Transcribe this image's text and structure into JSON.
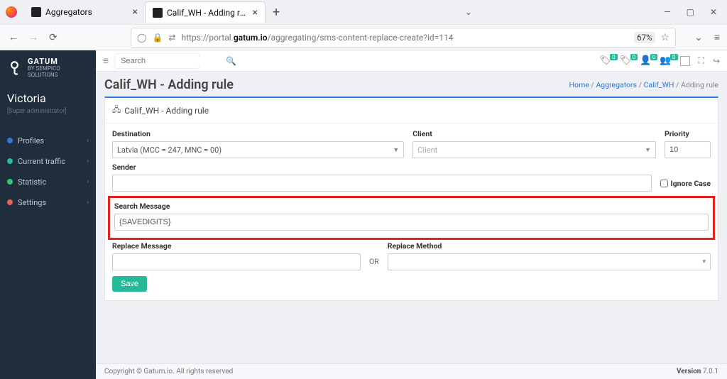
{
  "browser": {
    "tabs": [
      {
        "label": "Aggregators"
      },
      {
        "label": "Calif_WH - Adding rule"
      }
    ],
    "url_prefix": "https://portal.",
    "url_host": "gatum.io",
    "url_path": "/aggregating/sms-content-replace-create?id=114",
    "zoom": "67%"
  },
  "sidebar": {
    "brand_main": "GATUM",
    "brand_sub": "BY SEMPICO SOLUTIONS",
    "user_name": "Victoria",
    "user_role": "[Super administrator]",
    "items": [
      {
        "label": "Profiles",
        "color": "#2f77d0"
      },
      {
        "label": "Current traffic",
        "color": "#26b99a"
      },
      {
        "label": "Statistic",
        "color": "#2ecc71"
      },
      {
        "label": "Settings",
        "color": "#e96058"
      }
    ]
  },
  "topbar": {
    "search_placeholder": "Search",
    "badge": "0"
  },
  "page": {
    "title": "Calif_WH - Adding rule",
    "panel_title": "Calif_WH - Adding rule",
    "crumbs": {
      "home": "Home",
      "sep": " / ",
      "agg": "Aggregators",
      "calif": "Calif_WH",
      "adding": "Adding rule"
    },
    "labels": {
      "destination": "Destination",
      "client": "Client",
      "priority": "Priority",
      "sender": "Sender",
      "ignore": "Ignore Case",
      "search_msg": "Search Message",
      "replace_msg": "Replace Message",
      "or": "OR",
      "replace_method": "Replace Method",
      "save": "Save"
    },
    "values": {
      "destination": "Latvia (MCC = 247, MNC = 00)",
      "client_placeholder": "Client",
      "priority": "10",
      "search_message": "{SAVEDIGITS}"
    }
  },
  "footer": {
    "copyright": "Copyright © Gatum.io. All rights reserved",
    "version_label": "Version ",
    "version": "7.0.1"
  }
}
